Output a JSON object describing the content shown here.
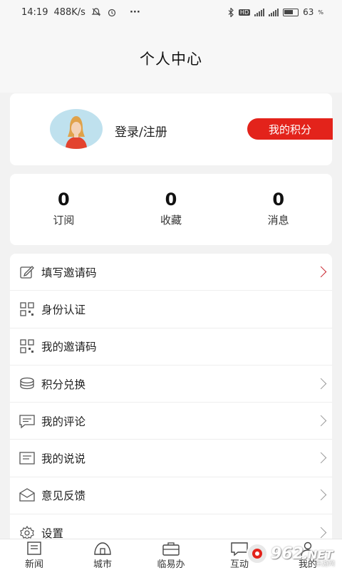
{
  "status": {
    "time": "14:19",
    "speed": "488K/s",
    "dots": "···",
    "battery": "63"
  },
  "header": {
    "title": "个人中心"
  },
  "profile": {
    "login_label": "登录/注册",
    "points_button": "我的积分"
  },
  "stats": [
    {
      "value": "0",
      "label": "订阅"
    },
    {
      "value": "0",
      "label": "收藏"
    },
    {
      "value": "0",
      "label": "消息"
    }
  ],
  "menu": [
    {
      "label": "填写邀请码",
      "icon": "edit-icon"
    },
    {
      "label": "身份认证",
      "icon": "qr-icon"
    },
    {
      "label": "我的邀请码",
      "icon": "qr-icon"
    },
    {
      "label": "积分兑换",
      "icon": "coins-icon"
    },
    {
      "label": "我的评论",
      "icon": "comment-icon"
    },
    {
      "label": "我的说说",
      "icon": "note-icon"
    },
    {
      "label": "意见反馈",
      "icon": "mail-icon"
    },
    {
      "label": "设置",
      "icon": "gear-icon"
    }
  ],
  "tabs": [
    {
      "label": "新闻",
      "icon": "news-icon"
    },
    {
      "label": "城市",
      "icon": "city-icon"
    },
    {
      "label": "临易办",
      "icon": "briefcase-icon"
    },
    {
      "label": "互动",
      "icon": "chat-icon"
    },
    {
      "label": "我的",
      "icon": "user-icon"
    }
  ],
  "watermark": {
    "text": "962",
    "suffix": ".NET",
    "sub": "乐游网"
  },
  "colors": {
    "accent": "#e3231b",
    "chevron_active": "#c8202a"
  }
}
